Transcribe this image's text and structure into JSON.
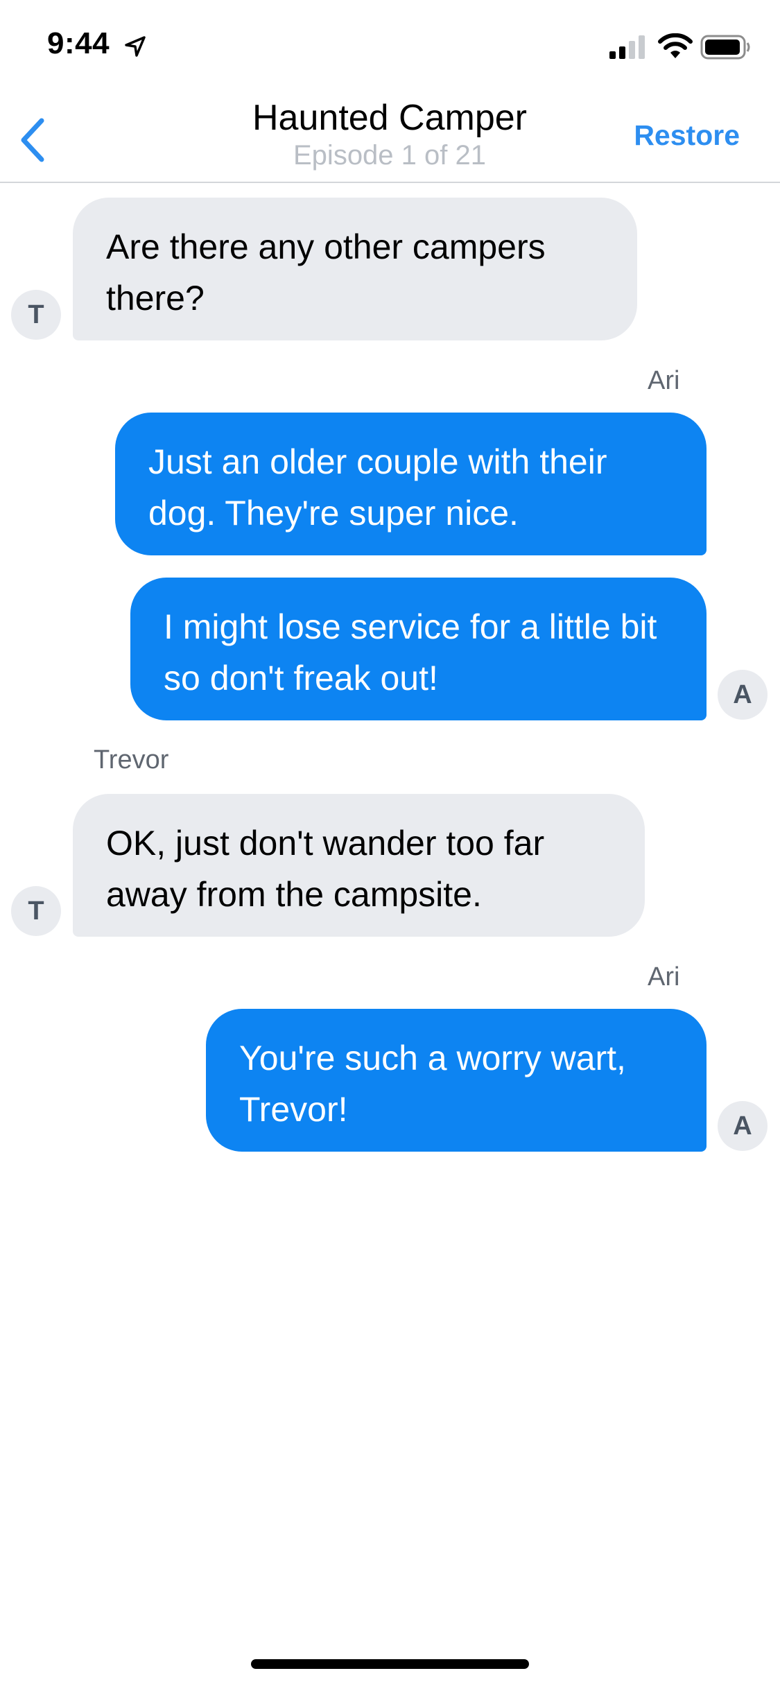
{
  "status_bar": {
    "time": "9:44",
    "icons": [
      "location-arrow-icon",
      "cellular-signal-icon",
      "wifi-icon",
      "battery-icon"
    ]
  },
  "header": {
    "title": "Haunted Camper",
    "subtitle": "Episode 1 of 21",
    "back_icon": "chevron-left-icon",
    "action_label": "Restore"
  },
  "colors": {
    "accent": "#2d8ef0",
    "outgoing_bubble": "#0d84f2",
    "incoming_bubble": "#e9ebef",
    "subtitle": "#b9bec5"
  },
  "messages": [
    {
      "sender_label": "",
      "avatar": "T",
      "direction": "incoming",
      "text": "Are there any other campers there?"
    },
    {
      "sender_label": "Ari",
      "avatar": "",
      "direction": "outgoing",
      "text": "Just an older couple with their dog. They're super nice."
    },
    {
      "sender_label": "",
      "avatar": "A",
      "direction": "outgoing",
      "text": "I might lose service for a little bit so don't freak out!"
    },
    {
      "sender_label": "Trevor",
      "avatar": "T",
      "direction": "incoming",
      "text": "OK, just don't wander too far away from the campsite."
    },
    {
      "sender_label": "Ari",
      "avatar": "A",
      "direction": "outgoing",
      "text": "You're such a worry wart, Trevor!"
    }
  ]
}
